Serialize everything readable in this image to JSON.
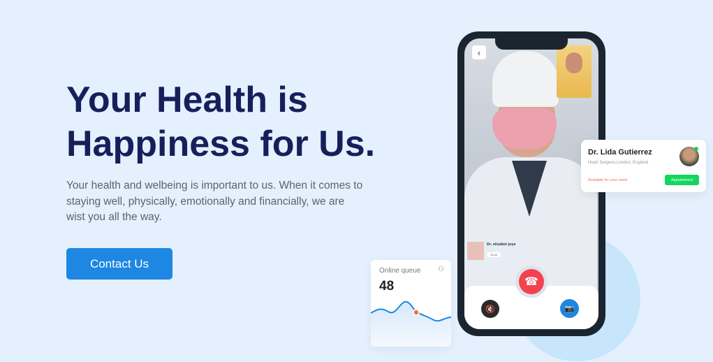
{
  "hero": {
    "title_line1": "Your Health is",
    "title_line2": "Happiness for Us.",
    "description": "Your health and welbeing is important to us. When it comes to staying well, physically, emotionally and financially, we are wist you all the way.",
    "cta_label": "Contact Us"
  },
  "call": {
    "caller_name": "Dr. elizabet joye",
    "caller_time": "15:40",
    "back_icon": "‹",
    "end_icon": "☎",
    "mute_icon": "🔇",
    "camera_icon": "📷"
  },
  "doctor_card": {
    "name": "Dr. Lida Gutierrez",
    "subtitle": "Heart Surgeon,London, England",
    "availability": "Available for your need",
    "button_label": "Appointment"
  },
  "queue": {
    "label": "Online queue",
    "value": "48",
    "icon": "users-icon"
  },
  "colors": {
    "accent": "#1d87e3",
    "title": "#15205b",
    "end_call": "#f3424e",
    "appointment": "#14d65e"
  }
}
